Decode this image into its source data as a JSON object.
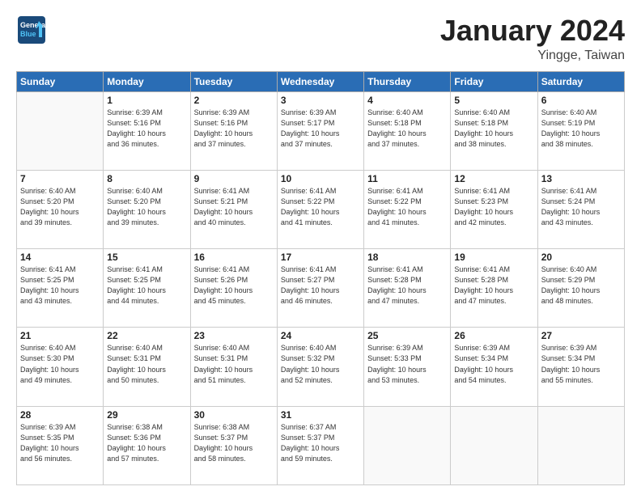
{
  "header": {
    "logo_line1": "General",
    "logo_line2": "Blue",
    "month_title": "January 2024",
    "location": "Yingge, Taiwan"
  },
  "weekdays": [
    "Sunday",
    "Monday",
    "Tuesday",
    "Wednesday",
    "Thursday",
    "Friday",
    "Saturday"
  ],
  "weeks": [
    [
      {
        "day": "",
        "info": ""
      },
      {
        "day": "1",
        "info": "Sunrise: 6:39 AM\nSunset: 5:16 PM\nDaylight: 10 hours\nand 36 minutes."
      },
      {
        "day": "2",
        "info": "Sunrise: 6:39 AM\nSunset: 5:16 PM\nDaylight: 10 hours\nand 37 minutes."
      },
      {
        "day": "3",
        "info": "Sunrise: 6:39 AM\nSunset: 5:17 PM\nDaylight: 10 hours\nand 37 minutes."
      },
      {
        "day": "4",
        "info": "Sunrise: 6:40 AM\nSunset: 5:18 PM\nDaylight: 10 hours\nand 37 minutes."
      },
      {
        "day": "5",
        "info": "Sunrise: 6:40 AM\nSunset: 5:18 PM\nDaylight: 10 hours\nand 38 minutes."
      },
      {
        "day": "6",
        "info": "Sunrise: 6:40 AM\nSunset: 5:19 PM\nDaylight: 10 hours\nand 38 minutes."
      }
    ],
    [
      {
        "day": "7",
        "info": "Sunrise: 6:40 AM\nSunset: 5:20 PM\nDaylight: 10 hours\nand 39 minutes."
      },
      {
        "day": "8",
        "info": "Sunrise: 6:40 AM\nSunset: 5:20 PM\nDaylight: 10 hours\nand 39 minutes."
      },
      {
        "day": "9",
        "info": "Sunrise: 6:41 AM\nSunset: 5:21 PM\nDaylight: 10 hours\nand 40 minutes."
      },
      {
        "day": "10",
        "info": "Sunrise: 6:41 AM\nSunset: 5:22 PM\nDaylight: 10 hours\nand 41 minutes."
      },
      {
        "day": "11",
        "info": "Sunrise: 6:41 AM\nSunset: 5:22 PM\nDaylight: 10 hours\nand 41 minutes."
      },
      {
        "day": "12",
        "info": "Sunrise: 6:41 AM\nSunset: 5:23 PM\nDaylight: 10 hours\nand 42 minutes."
      },
      {
        "day": "13",
        "info": "Sunrise: 6:41 AM\nSunset: 5:24 PM\nDaylight: 10 hours\nand 43 minutes."
      }
    ],
    [
      {
        "day": "14",
        "info": "Sunrise: 6:41 AM\nSunset: 5:25 PM\nDaylight: 10 hours\nand 43 minutes."
      },
      {
        "day": "15",
        "info": "Sunrise: 6:41 AM\nSunset: 5:25 PM\nDaylight: 10 hours\nand 44 minutes."
      },
      {
        "day": "16",
        "info": "Sunrise: 6:41 AM\nSunset: 5:26 PM\nDaylight: 10 hours\nand 45 minutes."
      },
      {
        "day": "17",
        "info": "Sunrise: 6:41 AM\nSunset: 5:27 PM\nDaylight: 10 hours\nand 46 minutes."
      },
      {
        "day": "18",
        "info": "Sunrise: 6:41 AM\nSunset: 5:28 PM\nDaylight: 10 hours\nand 47 minutes."
      },
      {
        "day": "19",
        "info": "Sunrise: 6:41 AM\nSunset: 5:28 PM\nDaylight: 10 hours\nand 47 minutes."
      },
      {
        "day": "20",
        "info": "Sunrise: 6:40 AM\nSunset: 5:29 PM\nDaylight: 10 hours\nand 48 minutes."
      }
    ],
    [
      {
        "day": "21",
        "info": "Sunrise: 6:40 AM\nSunset: 5:30 PM\nDaylight: 10 hours\nand 49 minutes."
      },
      {
        "day": "22",
        "info": "Sunrise: 6:40 AM\nSunset: 5:31 PM\nDaylight: 10 hours\nand 50 minutes."
      },
      {
        "day": "23",
        "info": "Sunrise: 6:40 AM\nSunset: 5:31 PM\nDaylight: 10 hours\nand 51 minutes."
      },
      {
        "day": "24",
        "info": "Sunrise: 6:40 AM\nSunset: 5:32 PM\nDaylight: 10 hours\nand 52 minutes."
      },
      {
        "day": "25",
        "info": "Sunrise: 6:39 AM\nSunset: 5:33 PM\nDaylight: 10 hours\nand 53 minutes."
      },
      {
        "day": "26",
        "info": "Sunrise: 6:39 AM\nSunset: 5:34 PM\nDaylight: 10 hours\nand 54 minutes."
      },
      {
        "day": "27",
        "info": "Sunrise: 6:39 AM\nSunset: 5:34 PM\nDaylight: 10 hours\nand 55 minutes."
      }
    ],
    [
      {
        "day": "28",
        "info": "Sunrise: 6:39 AM\nSunset: 5:35 PM\nDaylight: 10 hours\nand 56 minutes."
      },
      {
        "day": "29",
        "info": "Sunrise: 6:38 AM\nSunset: 5:36 PM\nDaylight: 10 hours\nand 57 minutes."
      },
      {
        "day": "30",
        "info": "Sunrise: 6:38 AM\nSunset: 5:37 PM\nDaylight: 10 hours\nand 58 minutes."
      },
      {
        "day": "31",
        "info": "Sunrise: 6:37 AM\nSunset: 5:37 PM\nDaylight: 10 hours\nand 59 minutes."
      },
      {
        "day": "",
        "info": ""
      },
      {
        "day": "",
        "info": ""
      },
      {
        "day": "",
        "info": ""
      }
    ]
  ]
}
